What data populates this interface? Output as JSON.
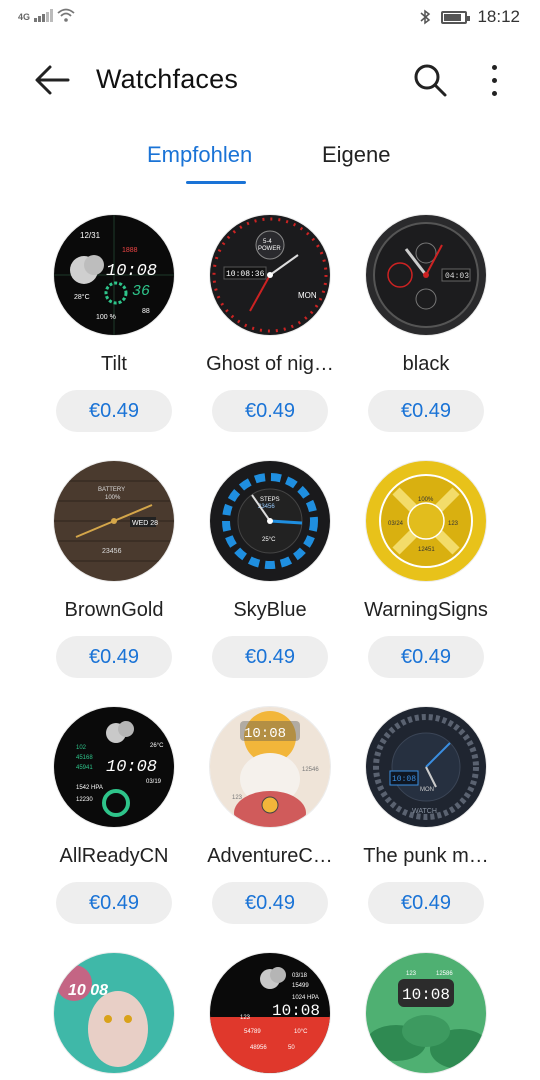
{
  "status_bar": {
    "network": "4G",
    "time": "18:12",
    "battery_level": 0.85
  },
  "header": {
    "title": "Watchfaces"
  },
  "tabs": [
    {
      "label": "Empfohlen",
      "active": true
    },
    {
      "label": "Eigene",
      "active": false
    }
  ],
  "colors": {
    "accent": "#1a73d6",
    "price_bg": "#eeeeee"
  },
  "watchfaces": [
    {
      "name": "Tilt",
      "price": "€0.49",
      "face_time": "10:08",
      "face_date": "12/31",
      "face_steps": "1888",
      "face_hr": "88",
      "face_temp": "28°C",
      "face_battery": "100 %",
      "face_small": "36"
    },
    {
      "name": "Ghost of nig…",
      "price": "€0.49",
      "face_time": "10:08:36",
      "face_power": "POWER",
      "face_power_value": "5-4",
      "face_day": "MON"
    },
    {
      "name": "black",
      "price": "€0.49",
      "face_time": "04:03"
    },
    {
      "name": "BrownGold",
      "price": "€0.49",
      "face_battery_label": "BATTERY",
      "face_battery": "100%",
      "face_date": "WED 28",
      "face_steps": "23456"
    },
    {
      "name": "SkyBlue",
      "price": "€0.49",
      "face_steps_label": "STEPS",
      "face_steps": "23456",
      "face_temp": "25°C"
    },
    {
      "name": "WarningSigns",
      "price": "€0.49",
      "face_battery": "100%",
      "face_date": "03/24",
      "face_hr": "123",
      "face_steps": "12451"
    },
    {
      "name": "AllReadyCN",
      "price": "€0.49",
      "face_time": "10:08",
      "face_date": "03/19",
      "face_temp": "26°C",
      "face_pressure": "1542 HPA",
      "face_steps": "12230",
      "face_v1": "102",
      "face_v2": "45168",
      "face_v3": "45941"
    },
    {
      "name": "AdventureC…",
      "price": "€0.49",
      "face_time": "10:08",
      "face_steps": "12546",
      "face_hr": "123"
    },
    {
      "name": "The punk m…",
      "price": "€0.49",
      "face_time": "10:08",
      "face_day": "MON",
      "face_brand": "WATCH"
    },
    {
      "name": "",
      "price": "",
      "face_time": "10 08"
    },
    {
      "name": "",
      "price": "",
      "face_time": "10:08",
      "face_date": "03/18",
      "face_steps": "15499",
      "face_pressure": "1024 HPA",
      "face_hr": "123",
      "face_kcal": "54789",
      "face_temp": "10°C",
      "face_floor": "48956",
      "face_battery": "50"
    },
    {
      "name": "",
      "price": "",
      "face_time": "10:08",
      "face_hr": "123",
      "face_steps": "12586"
    }
  ]
}
